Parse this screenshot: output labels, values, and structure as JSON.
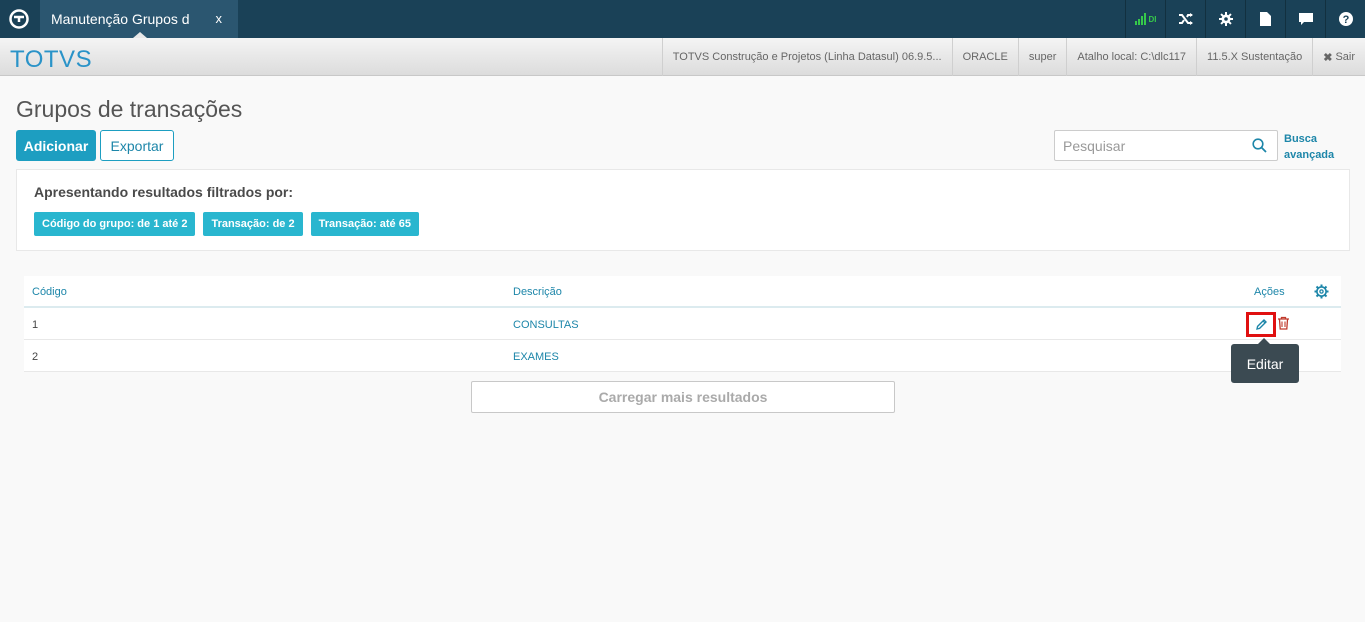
{
  "topbar": {
    "home_icon": "totvs-logo-icon",
    "tab_label": "Manutenção Grupos d",
    "tab_close": "x",
    "signal_label": "DI",
    "icons": [
      "signal-icon",
      "shuffle-icon",
      "gear-icon",
      "document-icon",
      "chat-icon",
      "help-icon"
    ]
  },
  "brandbar": {
    "brand": "TOTVS",
    "product": "TOTVS Construção e Projetos (Linha Datasul) 06.9.5...",
    "database": "ORACLE",
    "user": "super",
    "shortcut": "Atalho local: C:\\dlc117",
    "version": "11.5.X Sustentação",
    "logout": "Sair"
  },
  "page": {
    "title": "Grupos de transações",
    "add_label": "Adicionar",
    "export_label": "Exportar",
    "search_placeholder": "Pesquisar",
    "advanced_search_line1": "Busca",
    "advanced_search_line2": "avançada"
  },
  "filters": {
    "title": "Apresentando resultados filtrados por:",
    "chips": [
      "Código do grupo: de 1 até 2",
      "Transação: de 2",
      "Transação: até 65"
    ]
  },
  "table": {
    "headers": {
      "code": "Código",
      "description": "Descrição",
      "actions": "Ações"
    },
    "rows": [
      {
        "code": "1",
        "description": "CONSULTAS"
      },
      {
        "code": "2",
        "description": "EXAMES"
      }
    ],
    "tooltip": "Editar",
    "load_more": "Carregar mais resultados"
  },
  "colors": {
    "topbar": "#1a4157",
    "accent": "#1d9ec1",
    "chip": "#29b6cf",
    "highlight": "#e01010",
    "delete": "#c0392b"
  }
}
